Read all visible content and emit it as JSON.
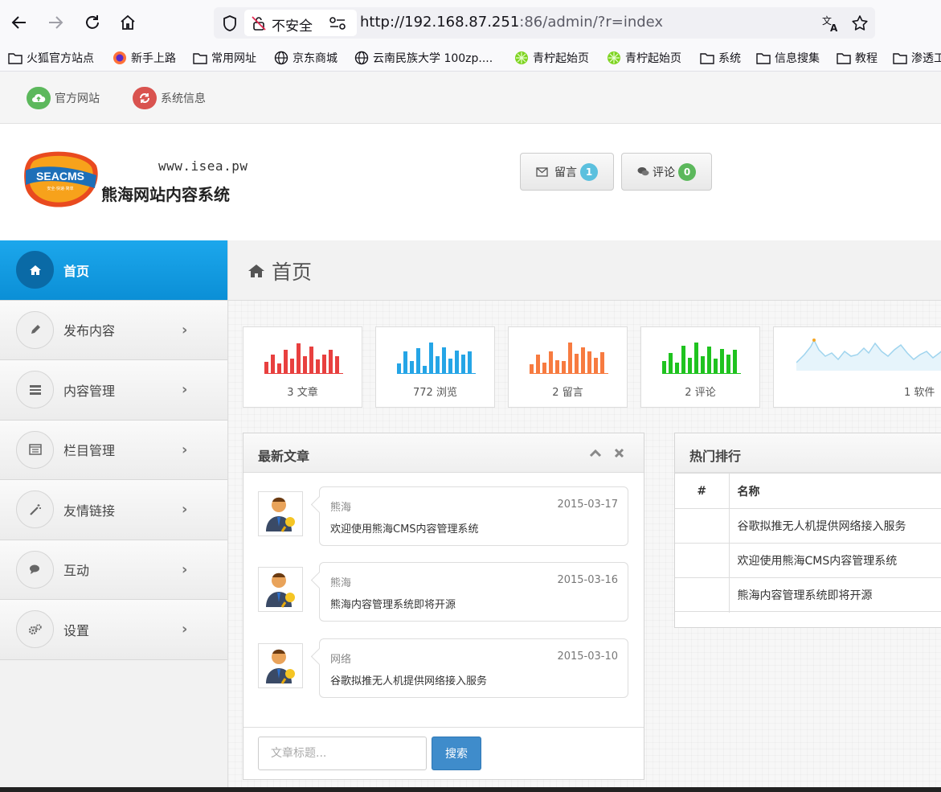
{
  "browser": {
    "security_label": "不安全",
    "url_host": "http://192.168.87.251",
    "url_rest": ":86/admin/?r=index",
    "bookmarks": [
      "火狐官方站点",
      "新手上路",
      "常用网址",
      "京东商城",
      "云南民族大学  100zp....",
      "青柠起始页",
      "青柠起始页",
      "系统",
      "信息搜集",
      "教程",
      "渗透工"
    ]
  },
  "topbar": {
    "official_site": "官方网站",
    "system_info": "系统信息"
  },
  "header": {
    "logo_text": "SEACMS",
    "logo_subtext": "安全·快速·简单",
    "www": "www.isea.pw",
    "site_name": "熊海网站内容系统",
    "messages_label": "留言",
    "messages_count": "1",
    "comments_label": "评论",
    "comments_count": "0"
  },
  "sidebar": {
    "items": [
      {
        "label": "首页"
      },
      {
        "label": "发布内容"
      },
      {
        "label": "内容管理"
      },
      {
        "label": "栏目管理"
      },
      {
        "label": "友情链接"
      },
      {
        "label": "互动"
      },
      {
        "label": "设置"
      }
    ],
    "chevron": "›"
  },
  "page": {
    "title": "首页"
  },
  "stats": [
    {
      "label": "3 文章",
      "color": "#e8403f"
    },
    {
      "label": "772 浏览",
      "color": "#25a5e6"
    },
    {
      "label": "2 留言",
      "color": "#f77b40"
    },
    {
      "label": "2 评论",
      "color": "#1fc31f"
    },
    {
      "label": "1 软件",
      "color": "#9fd4ee"
    }
  ],
  "latest": {
    "title": "最新文章",
    "articles": [
      {
        "author": "熊海",
        "date": "2015-03-17",
        "title": "欢迎使用熊海CMS内容管理系统"
      },
      {
        "author": "熊海",
        "date": "2015-03-16",
        "title": "熊海内容管理系统即将开源"
      },
      {
        "author": "网络",
        "date": "2015-03-10",
        "title": "谷歌拟推无人机提供网络接入服务"
      }
    ],
    "search_placeholder": "文章标题...",
    "search_button": "搜索"
  },
  "hot": {
    "title": "热门排行",
    "col_num": "#",
    "col_name": "名称",
    "rows": [
      {
        "num": "",
        "name": "谷歌拟推无人机提供网络接入服务"
      },
      {
        "num": "",
        "name": "欢迎使用熊海CMS内容管理系统"
      },
      {
        "num": "",
        "name": "熊海内容管理系统即将开源"
      }
    ]
  }
}
